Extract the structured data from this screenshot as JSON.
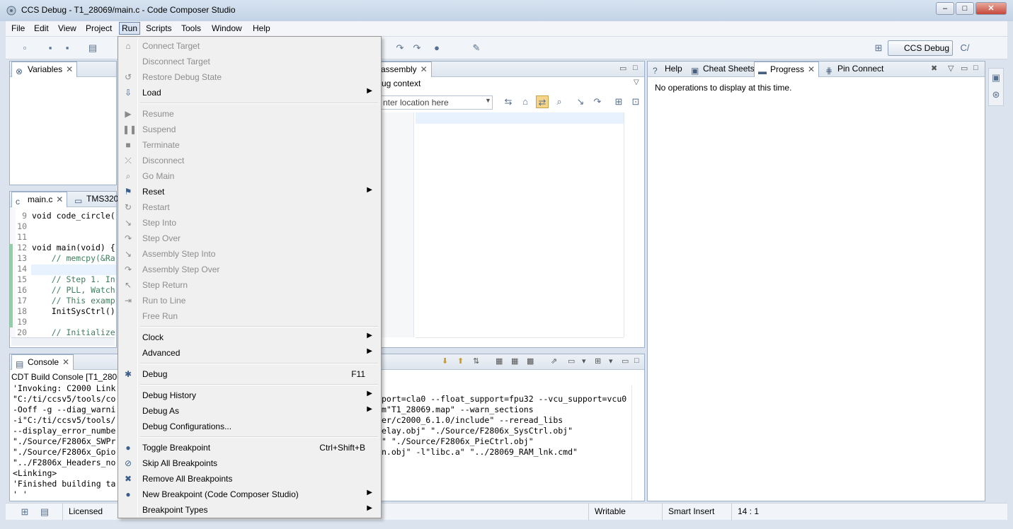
{
  "window": {
    "title": "CCS Debug - T1_28069/main.c - Code Composer Studio",
    "controls": [
      "–",
      "□",
      "✕"
    ]
  },
  "menubar": [
    "File",
    "Edit",
    "View",
    "Project",
    "Run",
    "Scripts",
    "Tools",
    "Window",
    "Help"
  ],
  "perspective": {
    "label": "CCS Debug",
    "next_label": "C/"
  },
  "variables_view": {
    "tab": "Variables"
  },
  "editor": {
    "tabs": [
      "main.c",
      "TMS320"
    ],
    "lines": [
      {
        "n": "9",
        "text": "void code_circle("
      },
      {
        "n": "10",
        "text": ""
      },
      {
        "n": "11",
        "text": ""
      },
      {
        "n": "12",
        "text": "void main(void) {"
      },
      {
        "n": "13",
        "text": "    // memcpy(&Ra"
      },
      {
        "n": "14",
        "text": ""
      },
      {
        "n": "15",
        "text": "    // Step 1. In"
      },
      {
        "n": "16",
        "text": "    // PLL, Watch"
      },
      {
        "n": "17",
        "text": "    // This examp"
      },
      {
        "n": "18",
        "text": "    InitSysCtrl()"
      },
      {
        "n": "19",
        "text": ""
      },
      {
        "n": "20",
        "text": "    // Initialize"
      }
    ]
  },
  "disassembly": {
    "tab": "Disassembly",
    "tab_visible": "assembly",
    "context": "ug context",
    "location_placeholder": "nter location here"
  },
  "right_panel": {
    "tabs": [
      "Help",
      "Cheat Sheets",
      "Progress",
      "Pin Connect"
    ],
    "message": "No operations to display at this time."
  },
  "console": {
    "tab": "Console",
    "header": "CDT Build Console [T1_2806",
    "left_lines": [
      "'Invoking: C2000 Link",
      "\"C:/ti/ccsv5/tools/co",
      "-Ooff -g --diag_warni",
      "-i\"C:/ti/ccsv5/tools/",
      "--display_error_numbe",
      "\"./Source/F2806x_SWPr",
      "\"./Source/F2806x_Gpio",
      "\"../F2806x_Headers_no",
      "<Linking>",
      "'Finished building ta",
      "' '"
    ],
    "right_lines": [
      "port=cla0 --float_support=fpu32 --vcu_support=vcu0",
      "m\"T1_28069.map\" --warn_sections",
      "er/c2000_6.1.0/include\" --reread_libs",
      "elay.obj\" \"./Source/F2806x_SysCtrl.obj\"",
      "\" \"./Source/F2806x_PieCtrl.obj\"",
      "n.obj\" -l\"libc.a\" \"../28069_RAM_lnk.cmd\""
    ]
  },
  "run_menu": {
    "items": [
      {
        "label": "Connect Target",
        "enabled": false,
        "icon": "connect-target-icon"
      },
      {
        "label": "Disconnect Target",
        "enabled": false,
        "icon": ""
      },
      {
        "label": "Restore Debug State",
        "enabled": false,
        "icon": "restore-icon"
      },
      {
        "label": "Load",
        "enabled": true,
        "submenu": true,
        "icon": "load-icon"
      },
      {
        "sep": true
      },
      {
        "label": "Resume",
        "enabled": false,
        "icon": "resume-icon"
      },
      {
        "label": "Suspend",
        "enabled": false,
        "icon": "suspend-icon"
      },
      {
        "label": "Terminate",
        "enabled": false,
        "icon": "terminate-icon"
      },
      {
        "label": "Disconnect",
        "enabled": false,
        "icon": "disconnect-icon"
      },
      {
        "label": "Go Main",
        "enabled": false,
        "icon": "go-main-icon"
      },
      {
        "label": "Reset",
        "enabled": true,
        "submenu": true,
        "icon": "reset-icon"
      },
      {
        "label": "Restart",
        "enabled": false,
        "icon": "restart-icon"
      },
      {
        "label": "Step Into",
        "enabled": false,
        "icon": "step-into-icon"
      },
      {
        "label": "Step Over",
        "enabled": false,
        "icon": "step-over-icon"
      },
      {
        "label": "Assembly Step Into",
        "enabled": false,
        "icon": "asm-step-into-icon"
      },
      {
        "label": "Assembly Step Over",
        "enabled": false,
        "icon": "asm-step-over-icon"
      },
      {
        "label": "Step Return",
        "enabled": false,
        "icon": "step-return-icon"
      },
      {
        "label": "Run to Line",
        "enabled": false,
        "icon": "run-to-line-icon"
      },
      {
        "label": "Free Run",
        "enabled": false,
        "icon": ""
      },
      {
        "sep": true
      },
      {
        "label": "Clock",
        "enabled": true,
        "submenu": true,
        "icon": ""
      },
      {
        "label": "Advanced",
        "enabled": true,
        "submenu": true,
        "icon": ""
      },
      {
        "sep": true
      },
      {
        "label": "Debug",
        "enabled": true,
        "shortcut": "F11",
        "icon": "debug-icon"
      },
      {
        "sep": true
      },
      {
        "label": "Debug History",
        "enabled": true,
        "submenu": true,
        "icon": ""
      },
      {
        "label": "Debug As",
        "enabled": true,
        "submenu": true,
        "icon": ""
      },
      {
        "label": "Debug Configurations...",
        "enabled": true,
        "icon": ""
      },
      {
        "sep": true
      },
      {
        "label": "Toggle Breakpoint",
        "enabled": true,
        "shortcut": "Ctrl+Shift+B",
        "icon": "breakpoint-icon"
      },
      {
        "label": "Skip All Breakpoints",
        "enabled": true,
        "icon": "skip-breakpoints-icon"
      },
      {
        "label": "Remove All Breakpoints",
        "enabled": true,
        "icon": "remove-breakpoints-icon"
      },
      {
        "label": "New Breakpoint (Code Composer Studio)",
        "enabled": true,
        "submenu": true,
        "icon": "new-breakpoint-icon"
      },
      {
        "label": "Breakpoint Types",
        "enabled": true,
        "submenu": true,
        "icon": ""
      }
    ]
  },
  "statusbar": {
    "license": "Licensed",
    "writable": "Writable",
    "insert_mode": "Smart Insert",
    "position": "14 : 1"
  }
}
